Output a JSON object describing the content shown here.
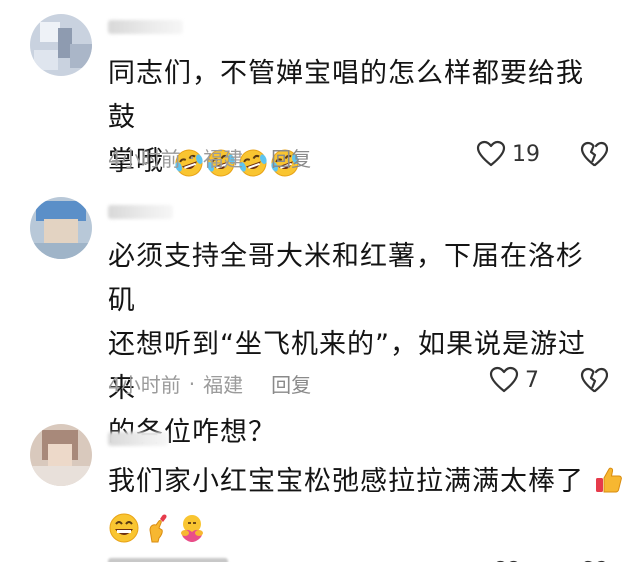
{
  "comments": [
    {
      "text_lines": [
        "同志们，不管婵宝唱的怎么样都要给我鼓",
        "掌哦"
      ],
      "emoji": [
        "rolling-laughing-emoji",
        "rolling-laughing-emoji",
        "rolling-laughing-emoji",
        "rolling-laughing-emoji"
      ],
      "time": "4小时前",
      "separator": "·",
      "location": "福建",
      "reply_label": "回复",
      "likes": "19"
    },
    {
      "text_lines": [
        "必须支持全哥大米和红薯，下届在洛杉矶",
        "还想听到“坐飞机来的”，如果说是游过来",
        "的各位咋想？"
      ],
      "time": "4小时前",
      "separator": "·",
      "location": "福建",
      "reply_label": "回复",
      "likes": "7"
    },
    {
      "text_lines": [
        "我们家小红宝宝松弛感拉拉满满太棒了"
      ],
      "emoji_inline": [
        "thumbs-up-emoji"
      ],
      "emoji": [
        "grinning-emoji",
        "pinched-fingers-heart-emoji",
        "hugging-heart-emoji"
      ]
    }
  ],
  "colors": {
    "text": "#141414",
    "meta": "#9b9b9b",
    "icon": "#333333"
  }
}
